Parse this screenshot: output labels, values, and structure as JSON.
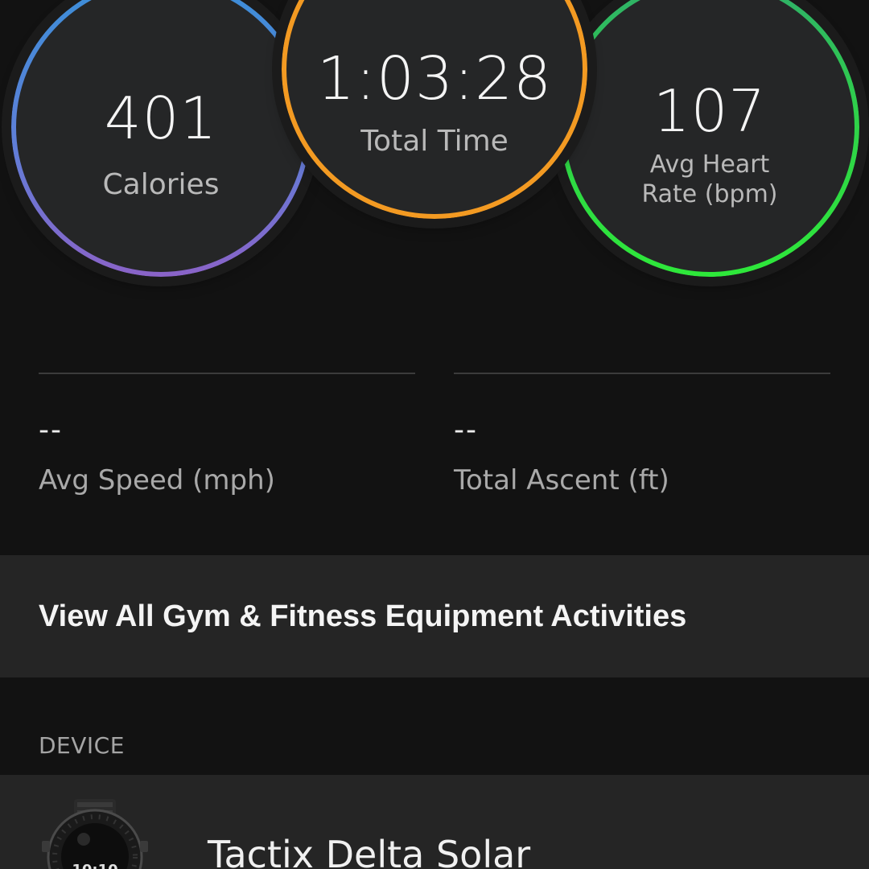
{
  "stats": {
    "calories": {
      "value": "401",
      "label": "Calories",
      "ring_color": "#6f75d6"
    },
    "total_time": {
      "value": "1:03:28",
      "label": "Total Time",
      "ring_color": "#f39a22"
    },
    "heart_rate": {
      "value": "107",
      "label": "Avg Heart Rate (bpm)",
      "ring_color": "#2ee83a"
    }
  },
  "secondary_stats": {
    "avg_speed": {
      "value": "--",
      "label": "Avg Speed (mph)"
    },
    "total_ascent": {
      "value": "--",
      "label": "Total Ascent (ft)"
    }
  },
  "view_all": {
    "label": "View All Gym & Fitness Equipment Activities"
  },
  "device_section": {
    "header": "DEVICE",
    "device_name": "Tactix Delta Solar",
    "device_icon": "smartwatch-icon"
  },
  "colors": {
    "background": "#121212",
    "row_background": "#252525",
    "circle_background": "#252627"
  }
}
